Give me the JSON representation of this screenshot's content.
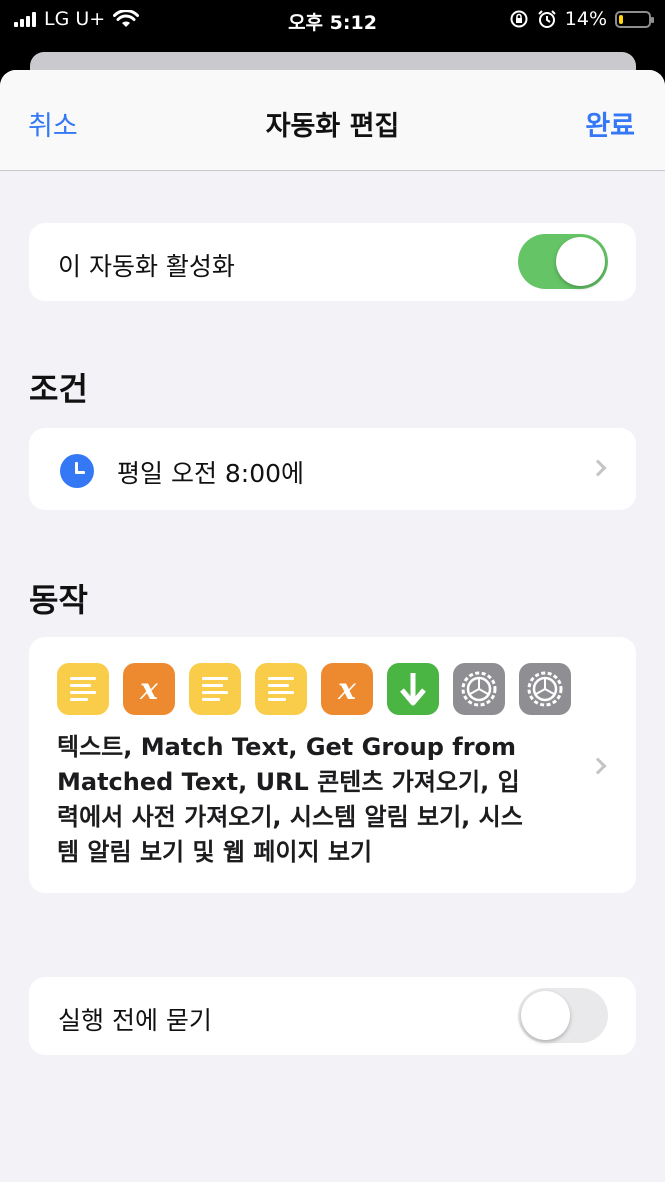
{
  "status_bar": {
    "carrier": "LG U+",
    "time": "오후 5:12",
    "battery_percent": "14%",
    "battery_level": 0.14
  },
  "nav": {
    "cancel_label": "취소",
    "title": "자동화 편집",
    "done_label": "완료"
  },
  "enable_row": {
    "label": "이 자동화 활성화",
    "toggle_on": true
  },
  "condition": {
    "section_title": "조건",
    "trigger_label": "평일 오전 8:00에",
    "icon": "clock-icon"
  },
  "actions": {
    "section_title": "동작",
    "icons": [
      "text-icon",
      "variable-icon",
      "text-icon",
      "text-icon",
      "variable-icon",
      "download-icon",
      "gear-icon",
      "gear-icon"
    ],
    "description": "텍스트, Match Text, Get Group from Matched Text, URL 콘텐츠 가져오기, 입력에서 사전 가져오기, 시스템 알림 보기, 시스템 알림 보기 및 웹 페이지 보기"
  },
  "ask_row": {
    "label": "실행 전에 묻기",
    "toggle_on": false
  },
  "colors": {
    "accent": "#3478f6",
    "toggle_on": "#65c466",
    "background": "#f2f2f7"
  }
}
